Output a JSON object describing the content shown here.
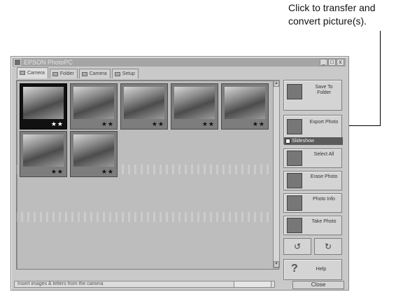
{
  "annotation": {
    "text": "Click to transfer and convert picture(s)."
  },
  "window": {
    "title": "EPSON PhotoPC",
    "buttons": [
      "_",
      "□",
      "x"
    ]
  },
  "tabs": [
    {
      "label": "Camera",
      "icon": "camera-icon",
      "active": true
    },
    {
      "label": "Folder",
      "icon": "folder-icon",
      "active": false
    },
    {
      "label": "Camera",
      "icon": "camera-icon",
      "active": false
    },
    {
      "label": "Setup",
      "icon": "setup-icon",
      "active": false
    }
  ],
  "thumbnails": [
    {
      "stars": "★★",
      "selected": true
    },
    {
      "stars": "★★",
      "selected": false
    },
    {
      "stars": "★★",
      "selected": false
    },
    {
      "stars": "★★",
      "selected": false
    },
    {
      "stars": "★★",
      "selected": false
    },
    {
      "stars": "★★",
      "selected": false
    },
    {
      "stars": "★★",
      "selected": false
    }
  ],
  "right_panel": {
    "save_to_folder": {
      "label": "Save To Folder"
    },
    "export_photo": {
      "label": "Export Photo",
      "strip": "Slideshow"
    },
    "select_all": {
      "label": "Select All"
    },
    "erase_photo": {
      "label": "Erase Photo"
    },
    "photo_info": {
      "label": "Photo Info"
    },
    "take_photo": {
      "label": "Take Photo"
    },
    "rotate_left": {
      "glyph": "↺"
    },
    "rotate_right": {
      "glyph": "↻"
    },
    "help": {
      "glyph": "?",
      "label": "Help"
    }
  },
  "status": {
    "text": "Insert images & letters from the camera",
    "progress": 0.0
  },
  "close_button": {
    "label": "Close"
  },
  "colors": {
    "window_bg": "#c9c9c9",
    "selected_thumb": "#111111",
    "export_strip": "#5b5b5b"
  }
}
